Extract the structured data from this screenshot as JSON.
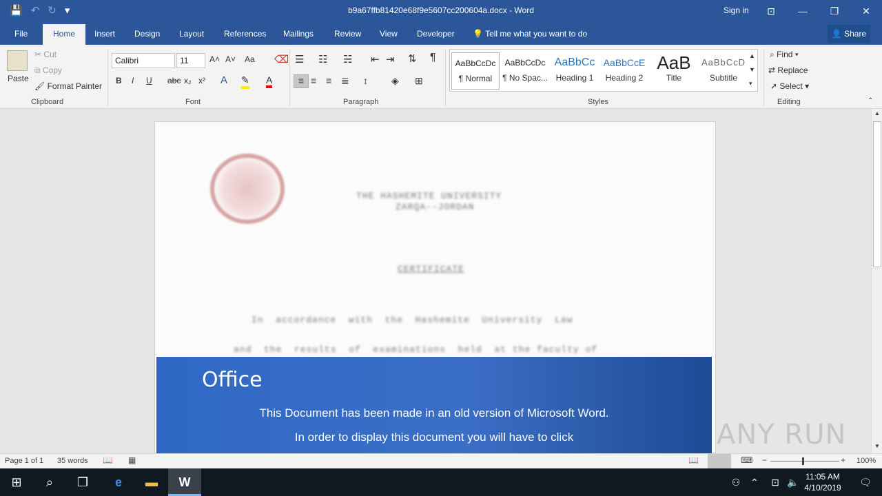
{
  "titlebar": {
    "title": "b9a67ffb81420e68f9e5607cc200604a.docx - Word",
    "signin": "Sign in",
    "save_icon": "💾",
    "undo_icon": "↶",
    "redo_icon": "↻",
    "customize_icon": "▾",
    "ribbon_display": "⊡",
    "minimize": "—",
    "restore": "❐",
    "close": "✕"
  },
  "tabs": [
    "File",
    "Home",
    "Insert",
    "Design",
    "Layout",
    "References",
    "Mailings",
    "Review",
    "View",
    "Developer"
  ],
  "tellme": "Tell me what you want to do",
  "share": "Share",
  "clipboard": {
    "paste": "Paste",
    "cut": "Cut",
    "copy": "Copy",
    "format_painter": "Format Painter",
    "label": "Clipboard"
  },
  "font": {
    "name": "Calibri",
    "size": "11",
    "label": "Font",
    "grow": "A˄",
    "shrink": "A˅",
    "case": "Aa",
    "bold": "B",
    "italic": "I",
    "underline": "U",
    "strike": "abc",
    "sub": "x₂",
    "sup": "x²"
  },
  "paragraph": {
    "label": "Paragraph",
    "show": "¶"
  },
  "styles": {
    "label": "Styles",
    "items": [
      {
        "preview": "AaBbCcDc",
        "name": "¶ Normal"
      },
      {
        "preview": "AaBbCcDc",
        "name": "¶ No Spac..."
      },
      {
        "preview": "AaBbCc",
        "name": "Heading 1"
      },
      {
        "preview": "AaBbCcE",
        "name": "Heading 2"
      },
      {
        "preview": "AaB",
        "name": "Title"
      },
      {
        "preview": "AaBbCcD",
        "name": "Subtitle"
      }
    ]
  },
  "editing": {
    "label": "Editing",
    "find": "Find",
    "replace": "Replace",
    "select": "Select"
  },
  "document": {
    "lines": [
      "THE HASHEMITE UNIVERSITY",
      "ZARQA--JORDAN",
      "CERTIFICATE",
      "In  accordance  with  the  Hashemite  University  Law",
      "and  the  results  of  examinations  held  at the faculty of"
    ]
  },
  "banner": {
    "heading": "Office",
    "line1": "This Document has been made in an old version of Microsoft Word.",
    "line2": "In order to display this document you will have to click"
  },
  "status": {
    "page": "Page 1 of 1",
    "words": "35 words",
    "zoom": "100%"
  },
  "taskbar": {
    "time": "11:05 AM",
    "date": "4/10/2019"
  },
  "watermark": "ANY RUN"
}
